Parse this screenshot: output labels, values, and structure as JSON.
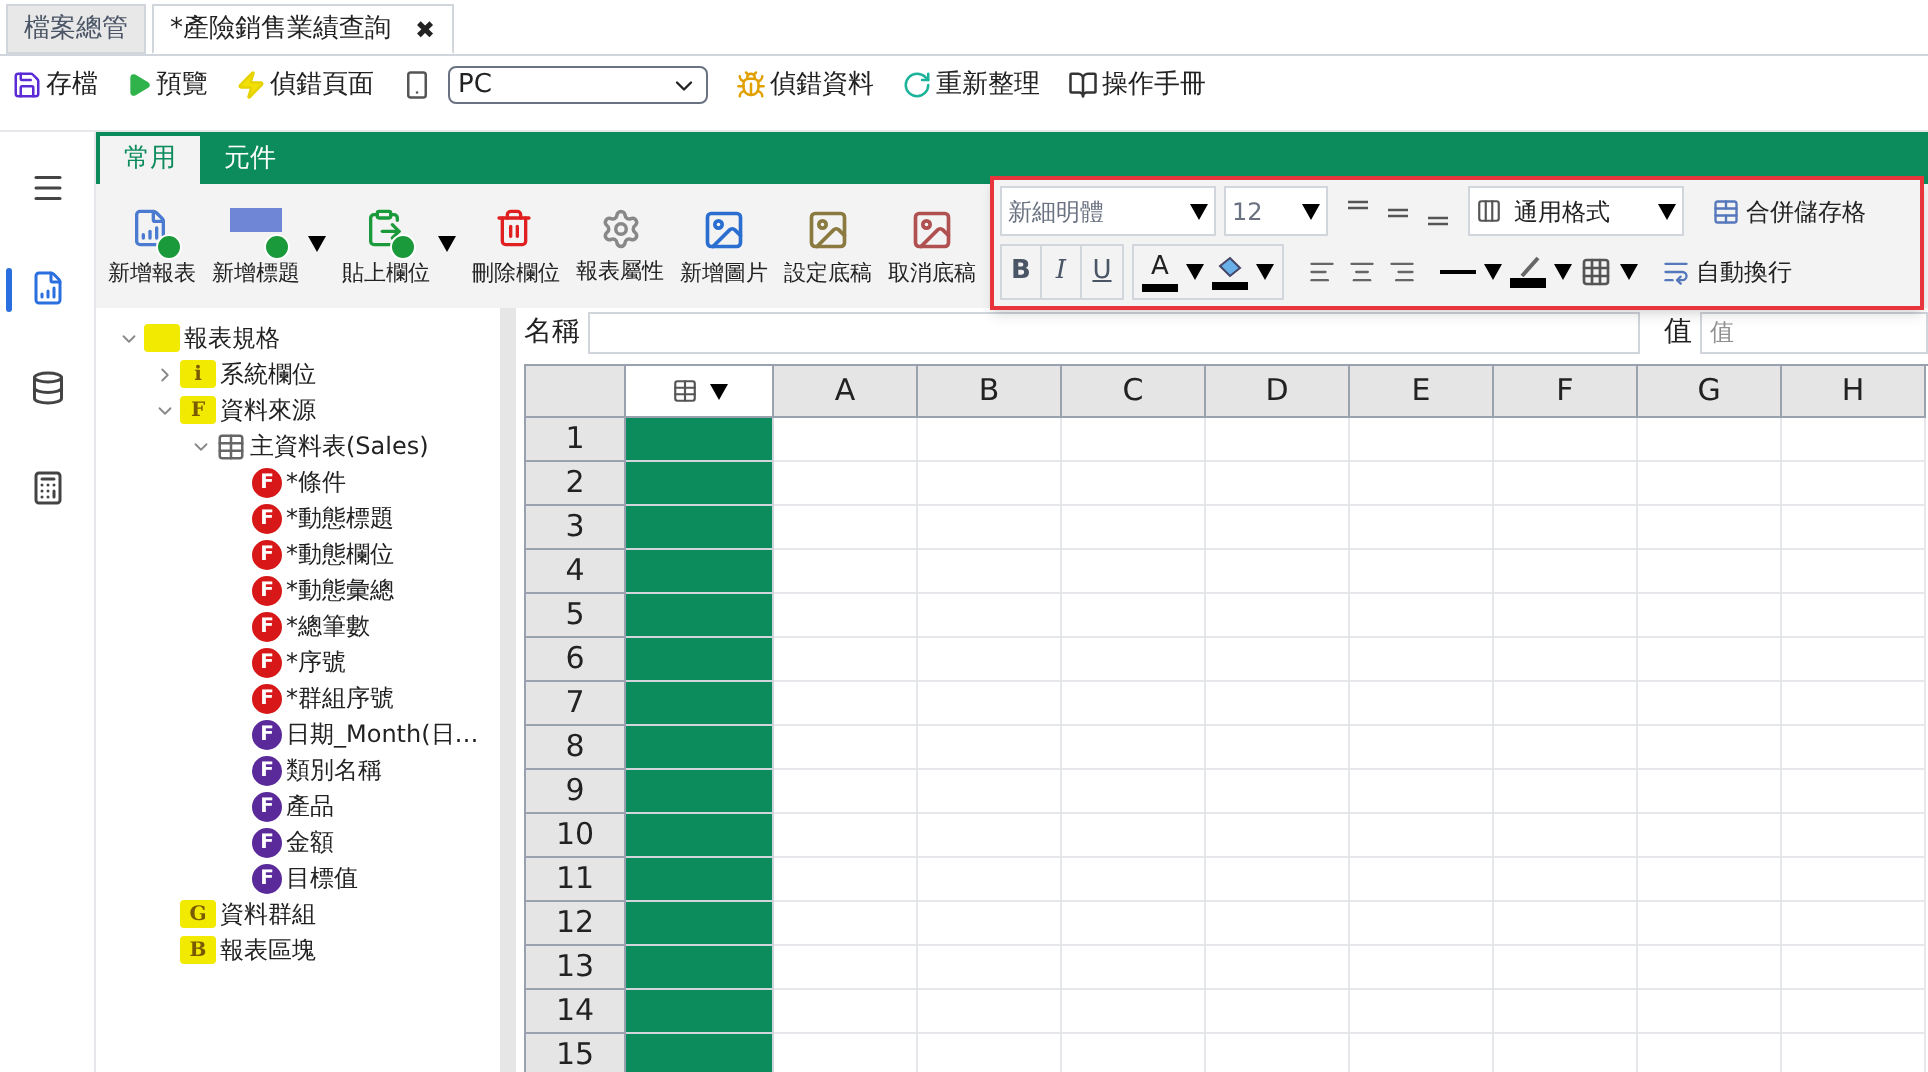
{
  "tabs": [
    {
      "label": "檔案總管",
      "selected": false
    },
    {
      "label": "*產險銷售業績查詢",
      "selected": true,
      "close": "✖"
    }
  ],
  "toolbar": [
    {
      "kind": "save",
      "label": "存檔"
    },
    {
      "kind": "preview",
      "label": "預覽"
    },
    {
      "kind": "debug-page",
      "label": "偵錯頁面"
    },
    {
      "kind": "device",
      "value": "PC"
    },
    {
      "kind": "debug-data",
      "label": "偵錯資料"
    },
    {
      "kind": "refresh",
      "label": "重新整理"
    },
    {
      "kind": "manual",
      "label": "操作手冊"
    }
  ],
  "sidebar": [
    {
      "kind": "menu",
      "selected": false
    },
    {
      "kind": "report",
      "selected": true
    },
    {
      "kind": "database",
      "selected": false
    },
    {
      "kind": "calc",
      "selected": false
    }
  ],
  "ribbon_tabs": [
    {
      "label": "常用",
      "selected": true
    },
    {
      "label": "元件",
      "selected": false
    }
  ],
  "ribbon_buttons": [
    {
      "kind": "new-report",
      "label": "新增報表",
      "dropdown": false
    },
    {
      "kind": "new-title",
      "label": "新增標題",
      "dropdown": true
    },
    {
      "kind": "paste-field",
      "label": "貼上欄位",
      "dropdown": true
    },
    {
      "kind": "delete-field",
      "label": "刪除欄位",
      "dropdown": false
    },
    {
      "kind": "properties",
      "label": "報表屬性",
      "dropdown": false
    },
    {
      "kind": "new-image",
      "label": "新增圖片",
      "dropdown": false
    },
    {
      "kind": "set-template",
      "label": "設定底稿",
      "dropdown": false
    },
    {
      "kind": "cancel-template",
      "label": "取消底稿",
      "dropdown": false
    }
  ],
  "format": {
    "font": "新細明體",
    "size": "12",
    "number_format": "通用格式",
    "merge": "合併儲存格",
    "wrap": "自動換行",
    "bold": "B",
    "italic": "I",
    "underline": "U",
    "font_color": "A"
  },
  "tree": [
    {
      "label": "報表規格",
      "kind": "folder",
      "expanded": true,
      "children": [
        {
          "label": "系統欄位",
          "kind": "folder",
          "badge": "i",
          "expanded": false
        },
        {
          "label": "資料來源",
          "kind": "folder",
          "badge": "F",
          "expanded": true,
          "children": [
            {
              "label": "主資料表(Sales)",
              "kind": "table",
              "expanded": true,
              "children": [
                {
                  "label": "*條件",
                  "kind": "calc",
                  "badge": "F"
                },
                {
                  "label": "*動態標題",
                  "kind": "calc",
                  "badge": "F"
                },
                {
                  "label": "*動態欄位",
                  "kind": "calc",
                  "badge": "F"
                },
                {
                  "label": "*動態彙總",
                  "kind": "calc",
                  "badge": "F"
                },
                {
                  "label": "*總筆數",
                  "kind": "calc",
                  "badge": "F"
                },
                {
                  "label": "*序號",
                  "kind": "calc",
                  "badge": "F"
                },
                {
                  "label": "*群組序號",
                  "kind": "calc",
                  "badge": "F"
                },
                {
                  "label": "日期_Month(日…",
                  "kind": "field",
                  "badge": "F"
                },
                {
                  "label": "類別名稱",
                  "kind": "field",
                  "badge": "F"
                },
                {
                  "label": "產品",
                  "kind": "field",
                  "badge": "F"
                },
                {
                  "label": "金額",
                  "kind": "field",
                  "badge": "F"
                },
                {
                  "label": "目標值",
                  "kind": "field",
                  "badge": "F"
                }
              ]
            }
          ]
        },
        {
          "label": "資料群組",
          "kind": "folder",
          "badge": "G"
        },
        {
          "label": "報表區塊",
          "kind": "folder",
          "badge": "B"
        }
      ]
    }
  ],
  "name_bar": {
    "label": "名稱",
    "value_label": "值",
    "value_placeholder": "值"
  },
  "grid": {
    "columns": [
      "A",
      "B",
      "C",
      "D",
      "E",
      "F",
      "G",
      "H"
    ],
    "rows": [
      "1",
      "2",
      "3",
      "4",
      "5",
      "6",
      "7",
      "8",
      "9",
      "10",
      "11",
      "12",
      "13",
      "14",
      "15"
    ]
  }
}
